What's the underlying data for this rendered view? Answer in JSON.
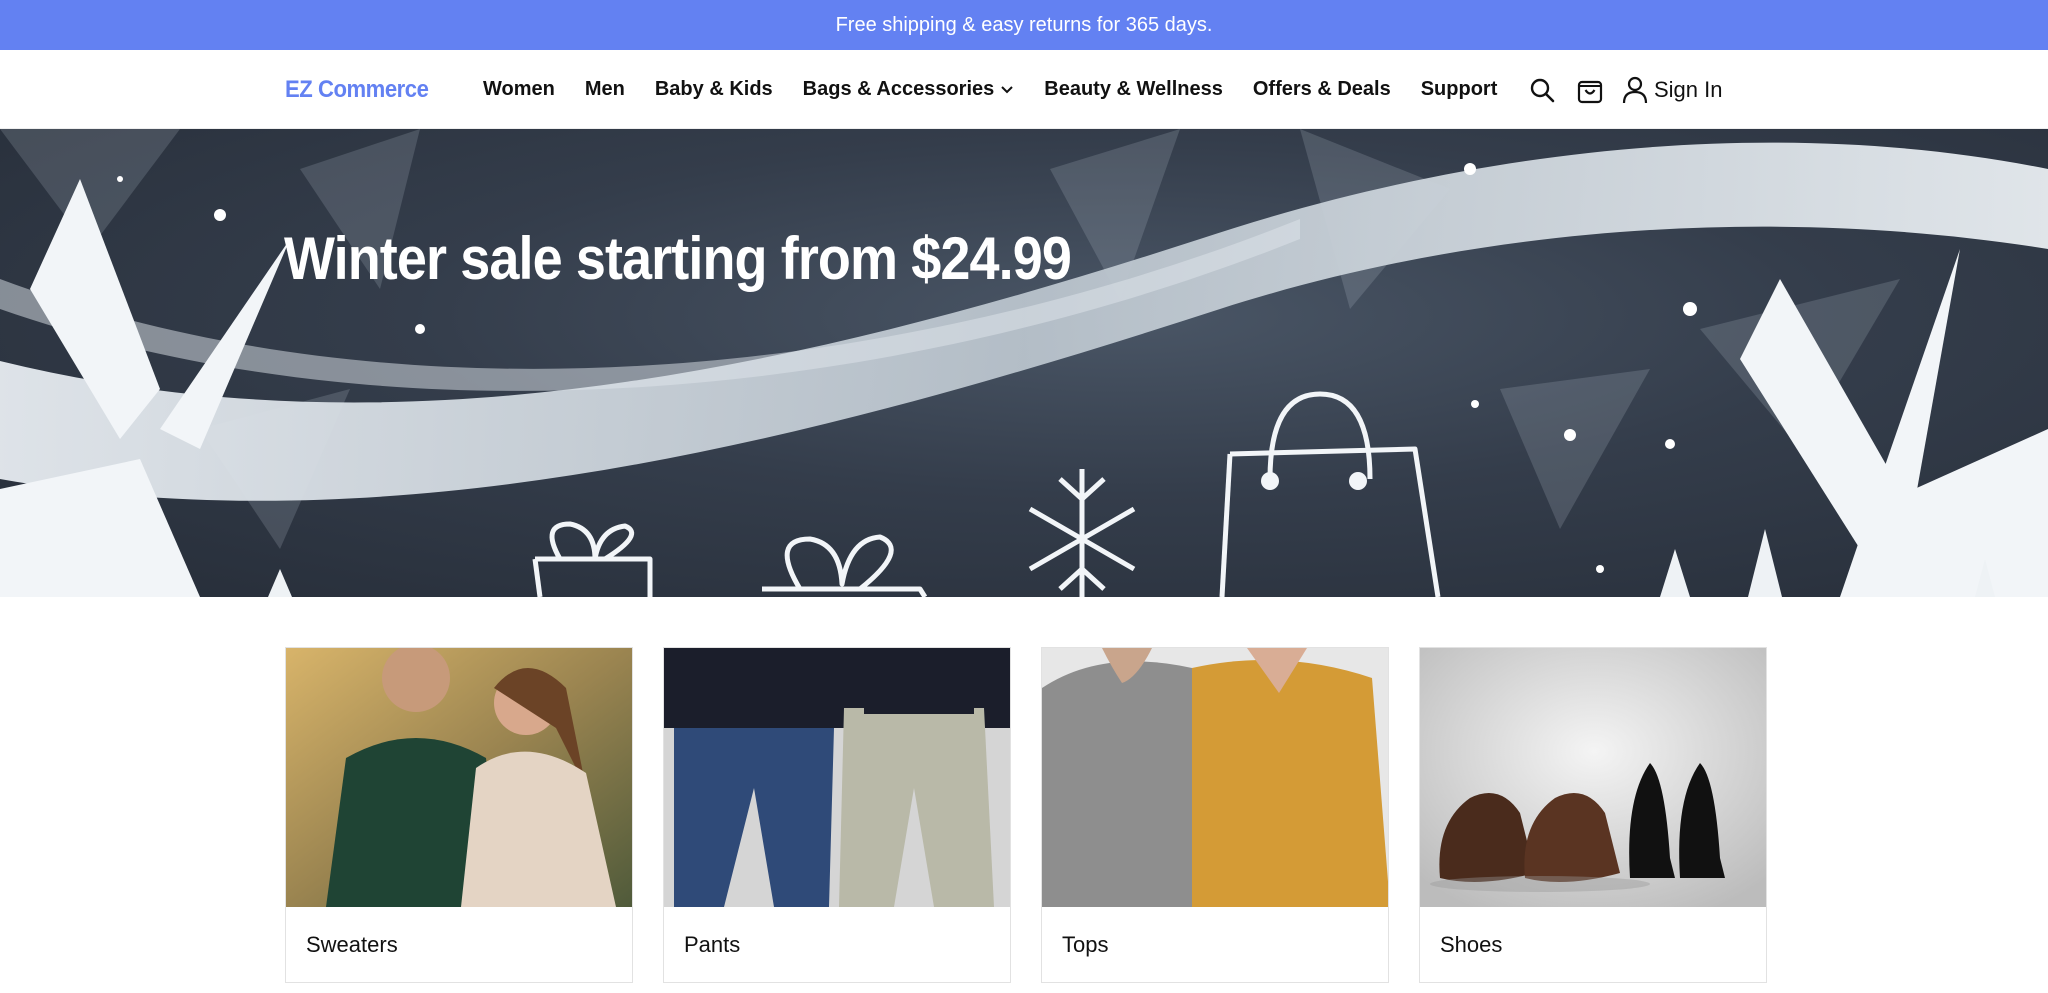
{
  "promo": {
    "text": "Free shipping & easy returns for 365 days."
  },
  "header": {
    "logo": "EZ Commerce",
    "nav": [
      {
        "label": "Women"
      },
      {
        "label": "Men"
      },
      {
        "label": "Baby & Kids"
      },
      {
        "label": "Bags & Accessories",
        "has_dropdown": true
      },
      {
        "label": "Beauty & Wellness"
      },
      {
        "label": "Offers & Deals"
      },
      {
        "label": "Support"
      }
    ],
    "icons": [
      "search-icon",
      "shopping-bag-icon",
      "user-icon"
    ],
    "sign_in": "Sign In"
  },
  "hero": {
    "title": "Winter sale starting from $24.99"
  },
  "categories": [
    {
      "label": "Sweaters"
    },
    {
      "label": "Pants"
    },
    {
      "label": "Tops"
    },
    {
      "label": "Shoes"
    }
  ],
  "colors": {
    "brand": "#6381f2",
    "promo_bg": "#6381f2",
    "text": "#111111"
  }
}
